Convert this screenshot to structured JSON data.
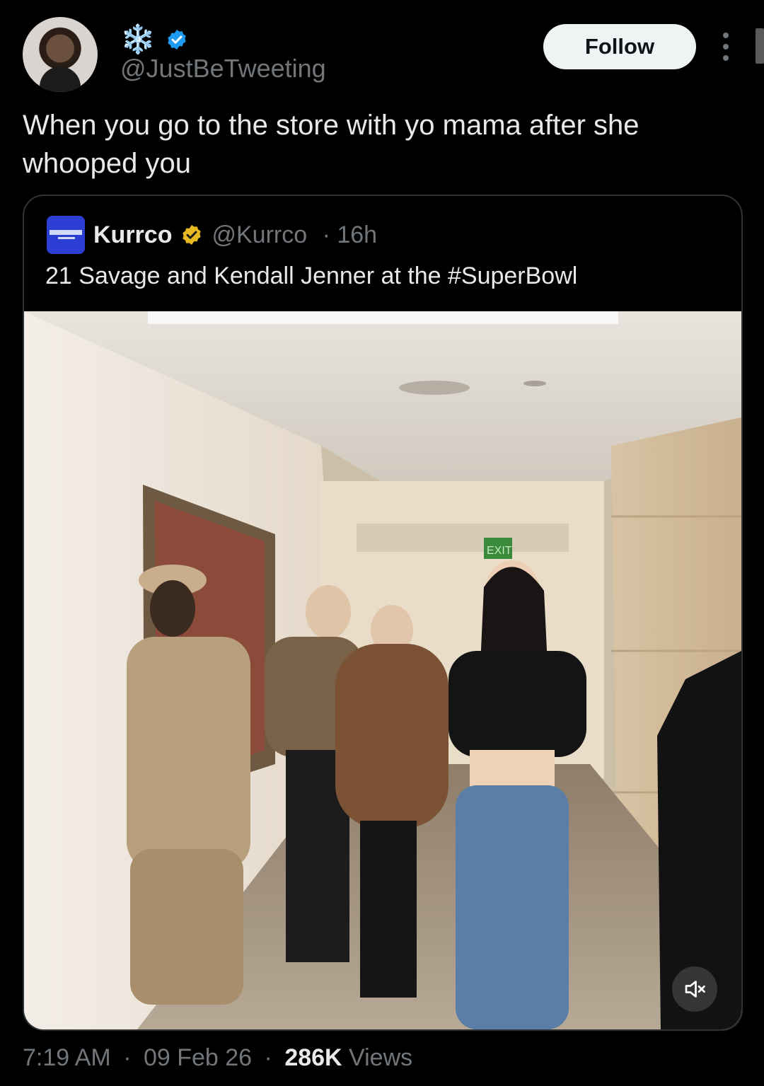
{
  "author": {
    "display_name": "❄️",
    "handle": "@JustBeTweeting",
    "verified_color": "#1d9bf0",
    "avatar_icon": "profile-photo"
  },
  "actions": {
    "follow_label": "Follow",
    "more_icon": "more-vertical-icon"
  },
  "tweet": {
    "text": "When you go to the store with yo mama after she whooped you"
  },
  "quoted": {
    "name": "Kurrco",
    "handle": "@Kurrco",
    "separator": " · ",
    "time": "16h",
    "verified_color": "#e8b923",
    "text": "21 Savage and Kendall Jenner at the #SuperBowl",
    "video": {
      "muted": true,
      "mute_icon": "volume-muted-icon",
      "sign_text": "EXIT"
    }
  },
  "footer": {
    "time": "7:19 AM",
    "sep1": " · ",
    "date": "09 Feb 26",
    "sep2": " · ",
    "views_count": "286K",
    "views_label": " Views"
  }
}
